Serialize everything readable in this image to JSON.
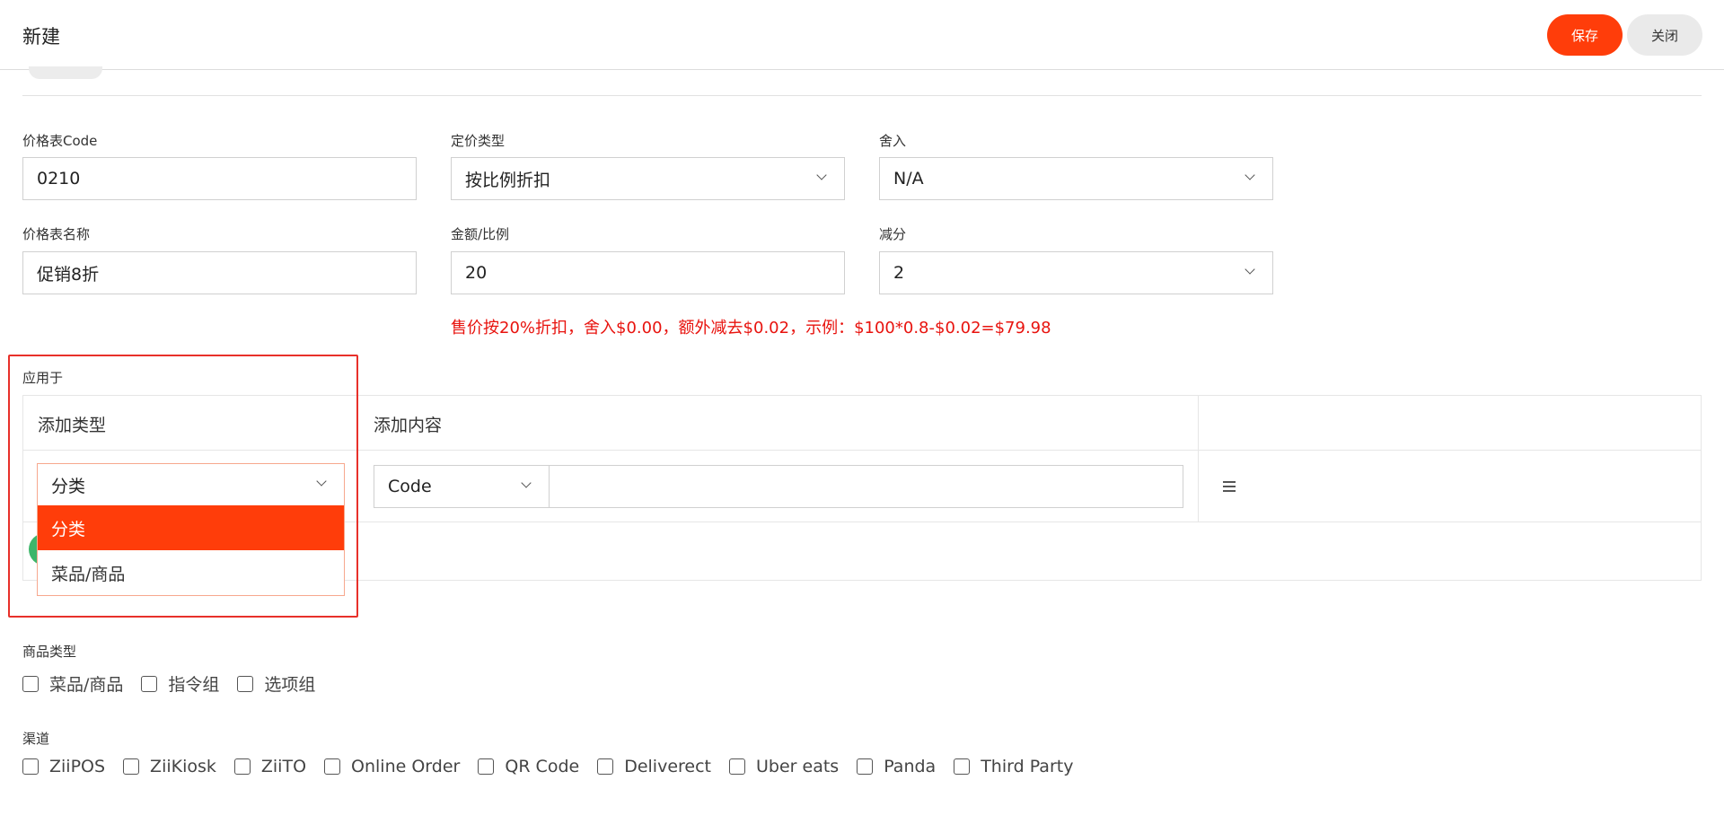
{
  "header": {
    "title": "新建",
    "save_label": "保存",
    "close_label": "关闭"
  },
  "form": {
    "code": {
      "label": "价格表Code",
      "value": "0210"
    },
    "pricing_type": {
      "label": "定价类型",
      "value": "按比例折扣"
    },
    "rounding": {
      "label": "舍入",
      "value": "N/A"
    },
    "name": {
      "label": "价格表名称",
      "value": "促销8折"
    },
    "amount_ratio": {
      "label": "金额/比例",
      "value": "20"
    },
    "deduct": {
      "label": "减分",
      "value": "2"
    },
    "hint": "售价按20%折扣，舍入$0.00，额外减去$0.02，示例：$100*0.8-$0.02=$79.98"
  },
  "apply_to": {
    "label": "应用于",
    "col_type": "添加类型",
    "col_content": "添加内容",
    "type_value": "分类",
    "content_select": "Code",
    "content_input": "",
    "dropdown_options": [
      "分类",
      "菜品/商品"
    ]
  },
  "product_types": {
    "label": "商品类型",
    "options": [
      "菜品/商品",
      "指令组",
      "选项组"
    ]
  },
  "channels": {
    "label": "渠道",
    "options": [
      "ZiiPOS",
      "ZiiKiosk",
      "ZiiTO",
      "Online Order",
      "QR Code",
      "Deliverect",
      "Uber eats",
      "Panda",
      "Third Party"
    ]
  },
  "colors": {
    "accent": "#ff3d0a",
    "hint": "#e8130e",
    "highlight": "#e8302a"
  }
}
